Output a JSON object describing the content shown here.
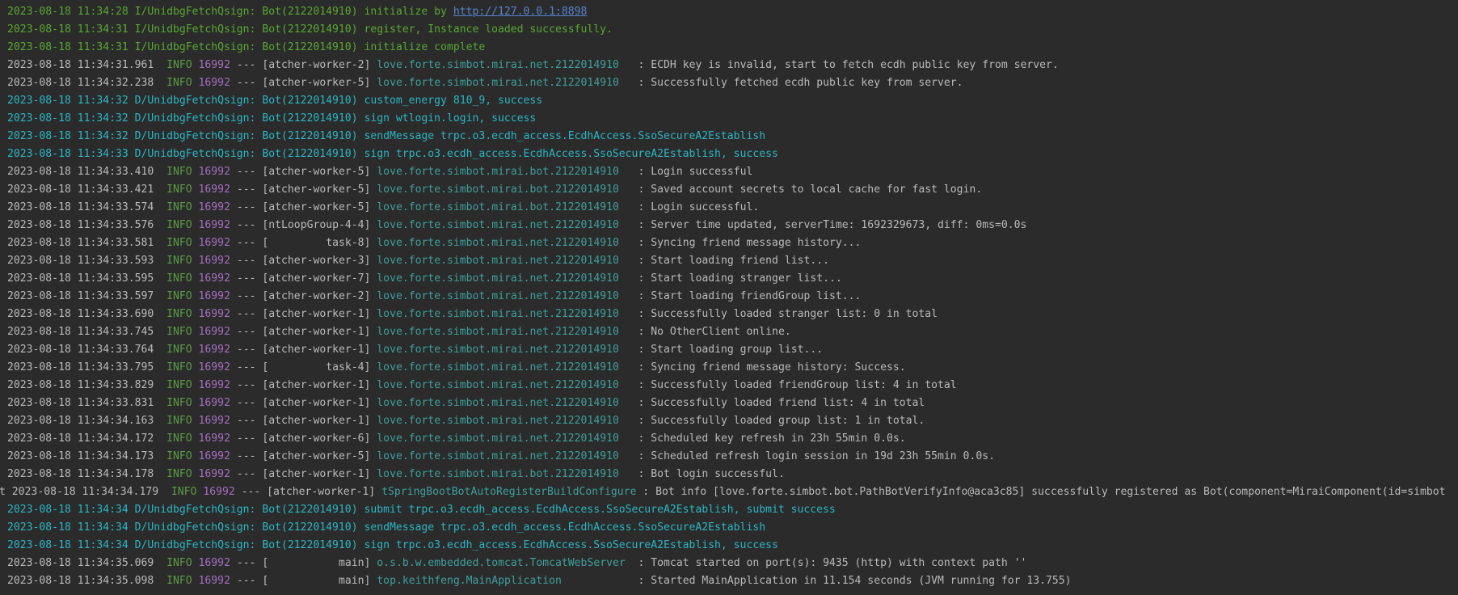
{
  "lines": [
    {
      "kind": "qsign",
      "color": "#59a831",
      "text": "2023-08-18 11:34:28 I/UnidbgFetchQsign: Bot(2122014910) initialize by ",
      "link": "http://127.0.0.1:8898"
    },
    {
      "kind": "qsign",
      "color": "#59a831",
      "text": "2023-08-18 11:34:31 I/UnidbgFetchQsign: Bot(2122014910) register, Instance loaded successfully."
    },
    {
      "kind": "qsign",
      "color": "#59a831",
      "text": "2023-08-18 11:34:31 I/UnidbgFetchQsign: Bot(2122014910) initialize complete"
    },
    {
      "kind": "spring",
      "ts": "2023-08-18 11:34:31.961",
      "level": "INFO",
      "pid": "16992",
      "sep": "---",
      "thread": "[atcher-worker-2]",
      "logger": "love.forte.simbot.mirai.net.2122014910  ",
      "msg": ": ECDH key is invalid, start to fetch ecdh public key from server."
    },
    {
      "kind": "spring",
      "ts": "2023-08-18 11:34:32.238",
      "level": "INFO",
      "pid": "16992",
      "sep": "---",
      "thread": "[atcher-worker-5]",
      "logger": "love.forte.simbot.mirai.net.2122014910  ",
      "msg": ": Successfully fetched ecdh public key from server."
    },
    {
      "kind": "qsign",
      "color": "#2bb7c4",
      "text": "2023-08-18 11:34:32 D/UnidbgFetchQsign: Bot(2122014910) custom_energy 810_9, success"
    },
    {
      "kind": "qsign",
      "color": "#2bb7c4",
      "text": "2023-08-18 11:34:32 D/UnidbgFetchQsign: Bot(2122014910) sign wtlogin.login, success"
    },
    {
      "kind": "qsign",
      "color": "#2bb7c4",
      "text": "2023-08-18 11:34:32 D/UnidbgFetchQsign: Bot(2122014910) sendMessage trpc.o3.ecdh_access.EcdhAccess.SsoSecureA2Establish"
    },
    {
      "kind": "qsign",
      "color": "#2bb7c4",
      "text": "2023-08-18 11:34:33 D/UnidbgFetchQsign: Bot(2122014910) sign trpc.o3.ecdh_access.EcdhAccess.SsoSecureA2Establish, success"
    },
    {
      "kind": "spring",
      "ts": "2023-08-18 11:34:33.410",
      "level": "INFO",
      "pid": "16992",
      "sep": "---",
      "thread": "[atcher-worker-5]",
      "logger": "love.forte.simbot.mirai.bot.2122014910  ",
      "msg": ": Login successful"
    },
    {
      "kind": "spring",
      "ts": "2023-08-18 11:34:33.421",
      "level": "INFO",
      "pid": "16992",
      "sep": "---",
      "thread": "[atcher-worker-5]",
      "logger": "love.forte.simbot.mirai.bot.2122014910  ",
      "msg": ": Saved account secrets to local cache for fast login."
    },
    {
      "kind": "spring",
      "ts": "2023-08-18 11:34:33.574",
      "level": "INFO",
      "pid": "16992",
      "sep": "---",
      "thread": "[atcher-worker-5]",
      "logger": "love.forte.simbot.mirai.bot.2122014910  ",
      "msg": ": Login successful."
    },
    {
      "kind": "spring",
      "ts": "2023-08-18 11:34:33.576",
      "level": "INFO",
      "pid": "16992",
      "sep": "---",
      "thread": "[ntLoopGroup-4-4]",
      "logger": "love.forte.simbot.mirai.net.2122014910  ",
      "msg": ": Server time updated, serverTime: 1692329673, diff: 0ms=0.0s"
    },
    {
      "kind": "spring",
      "ts": "2023-08-18 11:34:33.581",
      "level": "INFO",
      "pid": "16992",
      "sep": "---",
      "thread": "[         task-8]",
      "logger": "love.forte.simbot.mirai.net.2122014910  ",
      "msg": ": Syncing friend message history..."
    },
    {
      "kind": "spring",
      "ts": "2023-08-18 11:34:33.593",
      "level": "INFO",
      "pid": "16992",
      "sep": "---",
      "thread": "[atcher-worker-3]",
      "logger": "love.forte.simbot.mirai.net.2122014910  ",
      "msg": ": Start loading friend list..."
    },
    {
      "kind": "spring",
      "ts": "2023-08-18 11:34:33.595",
      "level": "INFO",
      "pid": "16992",
      "sep": "---",
      "thread": "[atcher-worker-7]",
      "logger": "love.forte.simbot.mirai.net.2122014910  ",
      "msg": ": Start loading stranger list..."
    },
    {
      "kind": "spring",
      "ts": "2023-08-18 11:34:33.597",
      "level": "INFO",
      "pid": "16992",
      "sep": "---",
      "thread": "[atcher-worker-2]",
      "logger": "love.forte.simbot.mirai.net.2122014910  ",
      "msg": ": Start loading friendGroup list..."
    },
    {
      "kind": "spring",
      "ts": "2023-08-18 11:34:33.690",
      "level": "INFO",
      "pid": "16992",
      "sep": "---",
      "thread": "[atcher-worker-1]",
      "logger": "love.forte.simbot.mirai.net.2122014910  ",
      "msg": ": Successfully loaded stranger list: 0 in total"
    },
    {
      "kind": "spring",
      "ts": "2023-08-18 11:34:33.745",
      "level": "INFO",
      "pid": "16992",
      "sep": "---",
      "thread": "[atcher-worker-1]",
      "logger": "love.forte.simbot.mirai.net.2122014910  ",
      "msg": ": No OtherClient online."
    },
    {
      "kind": "spring",
      "ts": "2023-08-18 11:34:33.764",
      "level": "INFO",
      "pid": "16992",
      "sep": "---",
      "thread": "[atcher-worker-1]",
      "logger": "love.forte.simbot.mirai.net.2122014910  ",
      "msg": ": Start loading group list..."
    },
    {
      "kind": "spring",
      "ts": "2023-08-18 11:34:33.795",
      "level": "INFO",
      "pid": "16992",
      "sep": "---",
      "thread": "[         task-4]",
      "logger": "love.forte.simbot.mirai.net.2122014910  ",
      "msg": ": Syncing friend message history: Success."
    },
    {
      "kind": "spring",
      "ts": "2023-08-18 11:34:33.829",
      "level": "INFO",
      "pid": "16992",
      "sep": "---",
      "thread": "[atcher-worker-1]",
      "logger": "love.forte.simbot.mirai.net.2122014910  ",
      "msg": ": Successfully loaded friendGroup list: 4 in total"
    },
    {
      "kind": "spring",
      "ts": "2023-08-18 11:34:33.831",
      "level": "INFO",
      "pid": "16992",
      "sep": "---",
      "thread": "[atcher-worker-1]",
      "logger": "love.forte.simbot.mirai.net.2122014910  ",
      "msg": ": Successfully loaded friend list: 4 in total"
    },
    {
      "kind": "spring",
      "ts": "2023-08-18 11:34:34.163",
      "level": "INFO",
      "pid": "16992",
      "sep": "---",
      "thread": "[atcher-worker-1]",
      "logger": "love.forte.simbot.mirai.net.2122014910  ",
      "msg": ": Successfully loaded group list: 1 in total."
    },
    {
      "kind": "spring",
      "ts": "2023-08-18 11:34:34.172",
      "level": "INFO",
      "pid": "16992",
      "sep": "---",
      "thread": "[atcher-worker-6]",
      "logger": "love.forte.simbot.mirai.net.2122014910  ",
      "msg": ": Scheduled key refresh in 23h 55min 0.0s."
    },
    {
      "kind": "spring",
      "ts": "2023-08-18 11:34:34.173",
      "level": "INFO",
      "pid": "16992",
      "sep": "---",
      "thread": "[atcher-worker-5]",
      "logger": "love.forte.simbot.mirai.net.2122014910  ",
      "msg": ": Scheduled refresh login session in 19d 23h 55min 0.0s."
    },
    {
      "kind": "spring",
      "ts": "2023-08-18 11:34:34.178",
      "level": "INFO",
      "pid": "16992",
      "sep": "---",
      "thread": "[atcher-worker-1]",
      "logger": "love.forte.simbot.mirai.bot.2122014910  ",
      "msg": ": Bot login successful."
    },
    {
      "kind": "spring",
      "prefix": "t ",
      "ts": "2023-08-18 11:34:34.179",
      "level": "INFO",
      "pid": "16992",
      "sep": "---",
      "thread": "[atcher-worker-1]",
      "logger": "tSpringBootBotAutoRegisterBuildConfigure",
      "msg": ": Bot info [love.forte.simbot.bot.PathBotVerifyInfo@aca3c85] successfully registered as Bot(component=MiraiComponent(id=simbot"
    },
    {
      "kind": "qsign",
      "color": "#2bb7c4",
      "text": "2023-08-18 11:34:34 D/UnidbgFetchQsign: Bot(2122014910) submit trpc.o3.ecdh_access.EcdhAccess.SsoSecureA2Establish, submit success"
    },
    {
      "kind": "qsign",
      "color": "#2bb7c4",
      "text": "2023-08-18 11:34:34 D/UnidbgFetchQsign: Bot(2122014910) sendMessage trpc.o3.ecdh_access.EcdhAccess.SsoSecureA2Establish"
    },
    {
      "kind": "qsign",
      "color": "#2bb7c4",
      "text": "2023-08-18 11:34:34 D/UnidbgFetchQsign: Bot(2122014910) sign trpc.o3.ecdh_access.EcdhAccess.SsoSecureA2Establish, success"
    },
    {
      "kind": "spring",
      "ts": "2023-08-18 11:34:35.069",
      "level": "INFO",
      "pid": "16992",
      "sep": "---",
      "thread": "[           main]",
      "logger": "o.s.b.w.embedded.tomcat.TomcatWebServer ",
      "msg": ": Tomcat started on port(s): 9435 (http) with context path ''"
    },
    {
      "kind": "spring",
      "ts": "2023-08-18 11:34:35.098",
      "level": "INFO",
      "pid": "16992",
      "sep": "---",
      "thread": "[           main]",
      "logger": "top.keithfeng.MainApplication           ",
      "msg": ": Started MainApplication in 11.154 seconds (JVM running for 13.755)"
    }
  ]
}
